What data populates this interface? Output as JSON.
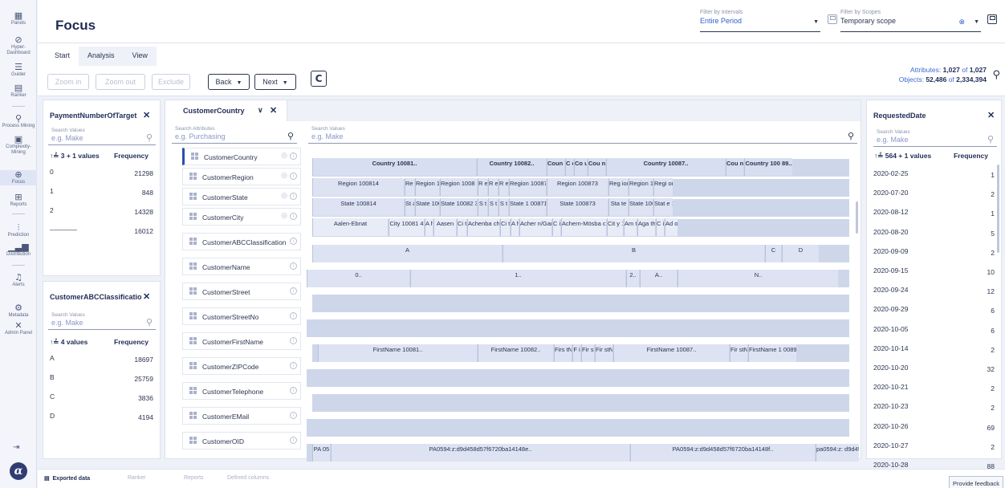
{
  "nav": {
    "items": [
      {
        "label": "Panels",
        "icon": "panels-icon",
        "glyph": "▦"
      },
      {
        "label": "Hyper-Dashboard",
        "icon": "dashboard-icon",
        "glyph": "⊘"
      },
      {
        "label": "Guider",
        "icon": "guider-icon",
        "glyph": "☰"
      },
      {
        "label": "Ranker",
        "icon": "ranker-icon",
        "glyph": "▤"
      },
      {
        "label": "Process Mining",
        "icon": "process-mining-icon",
        "glyph": "⚲"
      },
      {
        "label": "Complexity-Mining",
        "icon": "complexity-icon",
        "glyph": "▣"
      },
      {
        "label": "Focus",
        "icon": "focus-icon",
        "glyph": "⊕"
      },
      {
        "label": "Reports",
        "icon": "reports-icon",
        "glyph": "⊞"
      },
      {
        "label": "Prediction",
        "icon": "prediction-icon",
        "glyph": "⫶"
      },
      {
        "label": "Distribution",
        "icon": "distribution-icon",
        "glyph": "▁▃▆"
      },
      {
        "label": "Alerts",
        "icon": "bell-icon",
        "glyph": "♫"
      },
      {
        "label": "Metadata",
        "icon": "metadata-icon",
        "glyph": "⚙"
      },
      {
        "label": "Admin Panel",
        "icon": "admin-icon",
        "glyph": "✕"
      }
    ],
    "logo": "α",
    "exit_glyph": "⇥"
  },
  "header": {
    "title": "Focus",
    "interval_label": "Filter by Intervals",
    "interval_value": "Entire Period",
    "scope_label": "Filter by Scopes",
    "scope_value": "Temporary scope"
  },
  "tabs": [
    "Start",
    "Analysis",
    "View"
  ],
  "toolbar": {
    "zoom_in": "Zoom in",
    "zoom_out": "Zoom out",
    "exclude": "Exclude",
    "back": "Back",
    "next": "Next",
    "refresh": "C"
  },
  "stats": {
    "attributes_label": "Attributes:",
    "attributes_value": "1,027",
    "attributes_of": "of",
    "attributes_total": "1,027",
    "objects_label": "Objects:",
    "objects_value": "52,486",
    "objects_of": "of",
    "objects_total": "2,334,394"
  },
  "panel_payment": {
    "title": "PaymentNumberOfTarget",
    "search_label": "Search Values",
    "search_ph": "e.g. Make",
    "col_values": "3 + 1 values",
    "col_freq": "Frequency",
    "rows": [
      {
        "k": "0",
        "v": "21298"
      },
      {
        "k": "1",
        "v": "848"
      },
      {
        "k": "2",
        "v": "14328"
      },
      {
        "k": "————",
        "v": "16012"
      }
    ]
  },
  "panel_abc": {
    "title": "CustomerABCClassificatio",
    "search_label": "Search Values",
    "search_ph": "e.g. Make",
    "col_values": "4 values",
    "col_freq": "Frequency",
    "rows": [
      {
        "k": "A",
        "v": "18697"
      },
      {
        "k": "B",
        "v": "25759"
      },
      {
        "k": "C",
        "v": "3836"
      },
      {
        "k": "D",
        "v": "4194"
      }
    ]
  },
  "center": {
    "tab_label": "CustomerCountry",
    "attr_search_label": "Search Attributes",
    "attr_search_ph": "e.g. Purchasing",
    "val_search_label": "Search Values",
    "val_search_ph": "e.g. Make",
    "attributes": [
      "CustomerCountry",
      "CustomerRegion",
      "CustomerState",
      "CustomerCity",
      "CustomerABCClassification",
      "CustomerName",
      "CustomerStreet",
      "CustomerStreetNo",
      "CustomerFirstName",
      "CustomerZIPCode",
      "CustomerTelephone",
      "CustomerEMail",
      "CustomerOID"
    ],
    "country_cells": [
      "Country 10081..",
      "Country 10082..",
      "Coun try",
      "C o",
      "Co un",
      "Cou ntr",
      "Country 10087..",
      "Cou ntr",
      "Country 100 89.."
    ],
    "region_cells": [
      "Region 100814",
      "Re gi",
      "Region 100 822",
      "Region 1008 23",
      "R e",
      "R e",
      "R e",
      "Region 100871",
      "Region 100873",
      "Reg ion",
      "Region 10089",
      "Regi on 1"
    ],
    "state_cells": [
      "State 100814",
      "St at",
      "State 1008 22",
      "State 10082 3",
      "S t",
      "S t",
      "S t",
      "State 1 00871",
      "State 100873",
      "Sta te",
      "State 100893",
      "Stat e 10"
    ],
    "city_cells": [
      "Aalen-Ebnat",
      "City 10081 4",
      "A h",
      "Aasen",
      "Ci ty",
      "Achenba ch",
      "Ci ty",
      "A h",
      "Acher n/Gam",
      "C i",
      "Achern-Mösba ch",
      "Cit y 1",
      "Am ts",
      "Aga ths",
      "C i",
      "Ad ol"
    ],
    "abc_cells": [
      "A",
      "B",
      "C",
      "D"
    ],
    "name_cells": [
      "0..",
      "1..",
      "2..",
      "A..",
      "N.."
    ],
    "firstname_cells": [
      "FirstName 10081..",
      "FirstName 10082..",
      "Firs tNam",
      "F i",
      "Fir stN",
      "Fir stN",
      "FirstName 10087..",
      "Fir stN",
      "FirstName 1 0089.."
    ],
    "oid_cells": [
      "PA 05",
      "PA0594:z:d9d458d57f6720ba14148e..",
      "PA0594:z:d9d458d57f6720ba14148f..",
      "pa0594:z: d9d458d57"
    ]
  },
  "panel_date": {
    "title": "RequestedDate",
    "search_label": "Search Values",
    "search_ph": "e.g. Make",
    "col_values": "564 + 1 values",
    "col_freq": "Frequency",
    "rows": [
      {
        "k": "2020-02-25",
        "v": "1"
      },
      {
        "k": "2020-07-20",
        "v": "2"
      },
      {
        "k": "2020-08-12",
        "v": "1"
      },
      {
        "k": "2020-08-20",
        "v": "5"
      },
      {
        "k": "2020-09-09",
        "v": "2"
      },
      {
        "k": "2020-09-15",
        "v": "10"
      },
      {
        "k": "2020-09-24",
        "v": "12"
      },
      {
        "k": "2020-09-29",
        "v": "6"
      },
      {
        "k": "2020-10-05",
        "v": "6"
      },
      {
        "k": "2020-10-14",
        "v": "2"
      },
      {
        "k": "2020-10-20",
        "v": "32"
      },
      {
        "k": "2020-10-21",
        "v": "2"
      },
      {
        "k": "2020-10-23",
        "v": "2"
      },
      {
        "k": "2020-10-26",
        "v": "69"
      },
      {
        "k": "2020-10-27",
        "v": "2"
      },
      {
        "k": "2020-10-28",
        "v": "88"
      }
    ]
  },
  "bottom": {
    "tabs": [
      "Exported data",
      "Ranker",
      "Reports",
      "Defined columns"
    ],
    "feedback": "Provide feedback"
  },
  "sort_glyph": "↑≟"
}
